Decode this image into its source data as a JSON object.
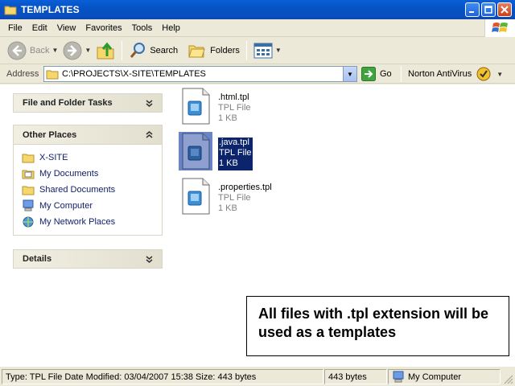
{
  "window": {
    "title": "TEMPLATES"
  },
  "menu": {
    "items": [
      {
        "label": "File"
      },
      {
        "label": "Edit"
      },
      {
        "label": "View"
      },
      {
        "label": "Favorites"
      },
      {
        "label": "Tools"
      },
      {
        "label": "Help"
      }
    ]
  },
  "toolbar": {
    "back_label": "Back",
    "search_label": "Search",
    "folders_label": "Folders"
  },
  "address": {
    "label": "Address",
    "path": "C:\\PROJECTS\\X-SITE\\TEMPLATES",
    "go_label": "Go",
    "norton_label": "Norton AntiVirus"
  },
  "tasks": {
    "file_folder_tasks": "File and Folder Tasks",
    "other_places": "Other Places",
    "details": "Details",
    "places": [
      {
        "label": "X-SITE",
        "icon": "folder-icon"
      },
      {
        "label": "My Documents",
        "icon": "documents-icon"
      },
      {
        "label": "Shared Documents",
        "icon": "folder-icon"
      },
      {
        "label": "My Computer",
        "icon": "computer-icon"
      },
      {
        "label": "My Network Places",
        "icon": "network-icon"
      }
    ]
  },
  "files": [
    {
      "name": ".html.tpl",
      "type": "TPL File",
      "size": "1 KB",
      "selected": false
    },
    {
      "name": ".java.tpl",
      "type": "TPL File",
      "size": "1 KB",
      "selected": true
    },
    {
      "name": ".properties.tpl",
      "type": "TPL File",
      "size": "1 KB",
      "selected": false
    }
  ],
  "callout": {
    "text": "All files with .tpl extension will be used as a templates"
  },
  "status": {
    "details": "Type: TPL File Date Modified: 03/04/2007 15:38 Size: 443 bytes",
    "size": "443 bytes",
    "location": "My Computer"
  },
  "colors": {
    "titlebar": "#0553c4",
    "selection": "#0b246b",
    "link": "#12206b"
  }
}
